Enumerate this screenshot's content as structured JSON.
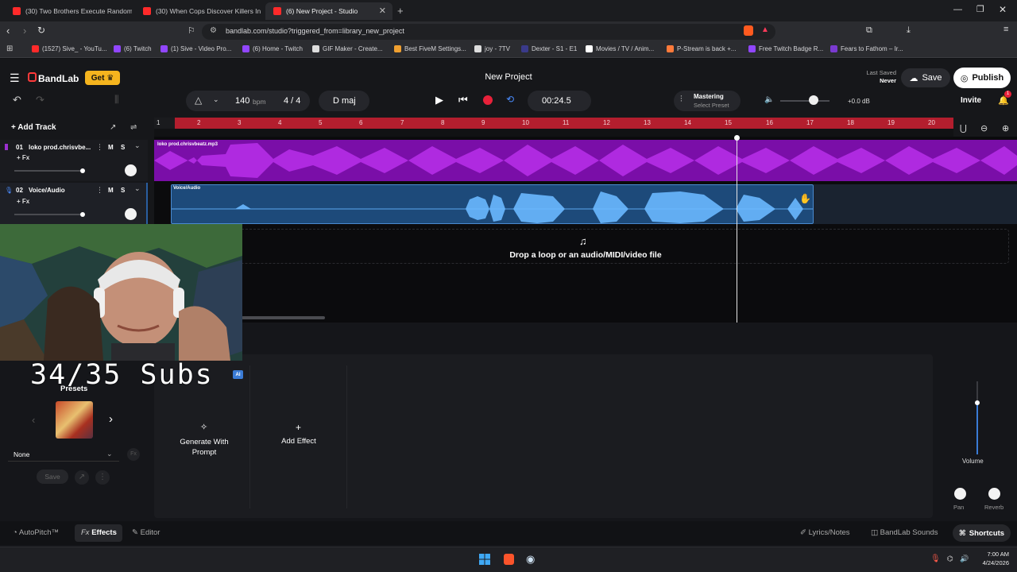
{
  "browser": {
    "tabs": [
      {
        "title": "(30) Two Brothers Execute Random G",
        "active": false
      },
      {
        "title": "(30) When Cops Discover Killers In Th",
        "active": false
      },
      {
        "title": "(6) New Project - Studio",
        "active": true
      }
    ],
    "url": "bandlab.com/studio?triggered_from=library_new_project",
    "bookmarks": [
      {
        "label": "(1527) Sive_ - YouTu...",
        "color": "#ff2a2a"
      },
      {
        "label": "(6) Twitch",
        "color": "#9146ff"
      },
      {
        "label": "(1) Sive - Video Pro...",
        "color": "#9146ff"
      },
      {
        "label": "(6) Home - Twitch",
        "color": "#9146ff"
      },
      {
        "label": "GIF Maker - Create...",
        "color": "#dddddd"
      },
      {
        "label": "Best FiveM Settings...",
        "color": "#f0a030"
      },
      {
        "label": "joy - 7TV",
        "color": "#dddddd"
      },
      {
        "label": "Dexter - S1 - E1",
        "color": "#3a3a8a"
      },
      {
        "label": "Movies / TV / Anim...",
        "color": "#ffffff"
      },
      {
        "label": "P-Stream is back +...",
        "color": "#ff7a3a"
      },
      {
        "label": "Free Twitch Badge R...",
        "color": "#9146ff"
      },
      {
        "label": "Fears to Fathom – Ir...",
        "color": "#7a3ad0"
      }
    ]
  },
  "header": {
    "brand": "BandLab",
    "get_label": "Get",
    "project_title": "New Project",
    "last_saved_label": "Last Saved",
    "last_saved_value": "Never",
    "save_label": "Save",
    "publish_label": "Publish"
  },
  "transport": {
    "bpm": "140",
    "bpm_unit": "bpm",
    "time_signature": "4 / 4",
    "key": "D maj",
    "time": "00:24.5",
    "mastering_title": "Mastering",
    "mastering_preset": "Select Preset",
    "volume_db": "+0.0 dB",
    "invite_label": "Invite",
    "notification_count": "1"
  },
  "tracks_header": {
    "add_track_label": "Add Track"
  },
  "tracks": [
    {
      "number": "01",
      "name": "loko prod.chrisvbe...",
      "fx": "+ Fx",
      "mute": "M",
      "solo": "S",
      "region_label": "loko prod.chrisvbeatz.mp3",
      "color": "#7a0ea8"
    },
    {
      "number": "02",
      "name": "Voice/Audio",
      "fx": "+ Fx",
      "mute": "M",
      "solo": "S",
      "region_label": "Voice/Audio",
      "color": "#1d4a7a"
    }
  ],
  "ruler": [
    "1",
    "2",
    "3",
    "4",
    "5",
    "6",
    "7",
    "8",
    "9",
    "10",
    "11",
    "12",
    "13",
    "14",
    "15",
    "16",
    "17",
    "18",
    "19",
    "20"
  ],
  "drop_zone_text": "Drop a loop or an audio/MIDI/video file",
  "overlay": {
    "subs_text": "34/35 Subs",
    "ai_badge": "AI"
  },
  "effects_panel": {
    "presets_label": "Presets",
    "preset_select_value": "None",
    "save_label": "Save",
    "generate_label": "Generate With Prompt",
    "add_effect_label": "Add Effect",
    "volume_label": "Volume",
    "pan_label": "Pan",
    "reverb_label": "Reverb"
  },
  "bottom_bar": {
    "autopitch": "AutoPitch™",
    "effects": "Effects",
    "effects_prefix": "Fx",
    "editor": "Editor",
    "lyrics": "Lyrics/Notes",
    "sounds": "BandLab Sounds",
    "shortcuts": "Shortcuts"
  },
  "taskbar": {
    "time": "7:00 AM",
    "date": "4/24/2026"
  }
}
